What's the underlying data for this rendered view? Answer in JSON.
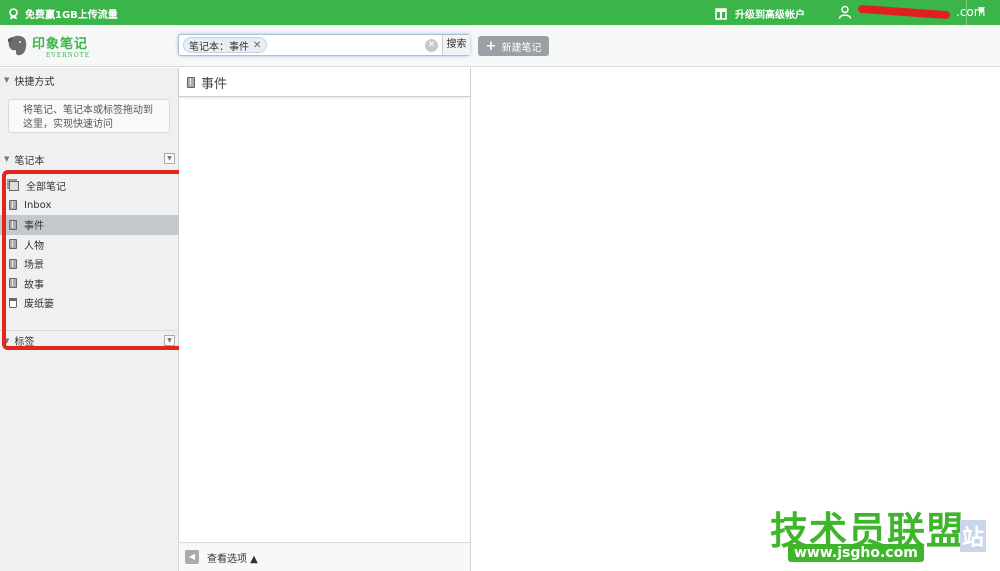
{
  "topbar": {
    "promo": "免费赢1GB上传流量",
    "upgrade": "升级到高级帐户",
    "account_suffix": ".com"
  },
  "header": {
    "logo_cn": "印象笔记",
    "logo_en": "EVERNOTE",
    "search_chip": "笔记本：事件",
    "search_button": "搜索",
    "new_note": "新建笔记"
  },
  "sidebar": {
    "shortcuts_title": "快捷方式",
    "shortcuts_hint": "将笔记、笔记本或标签拖动到这里，实现快速访问",
    "notebooks_title": "笔记本",
    "notebooks": [
      {
        "label": "全部笔记",
        "icon": "all-notes-icon"
      },
      {
        "label": "Inbox",
        "icon": "notebook-icon"
      },
      {
        "label": "事件",
        "icon": "notebook-icon",
        "selected": true
      },
      {
        "label": "人物",
        "icon": "notebook-icon"
      },
      {
        "label": "场景",
        "icon": "notebook-icon"
      },
      {
        "label": "故事",
        "icon": "notebook-icon"
      },
      {
        "label": "废纸篓",
        "icon": "trash-icon"
      }
    ],
    "tags_title": "标签"
  },
  "notelist": {
    "title": "事件",
    "view_options": "查看选项 ▲"
  },
  "watermark": {
    "text": "技术员联盟",
    "url": "www.jsgho.com",
    "suffix": "站"
  },
  "colors": {
    "brand_green": "#3bb44a",
    "highlight_red": "#e2261d",
    "selected_row": "#c3c9cd"
  }
}
